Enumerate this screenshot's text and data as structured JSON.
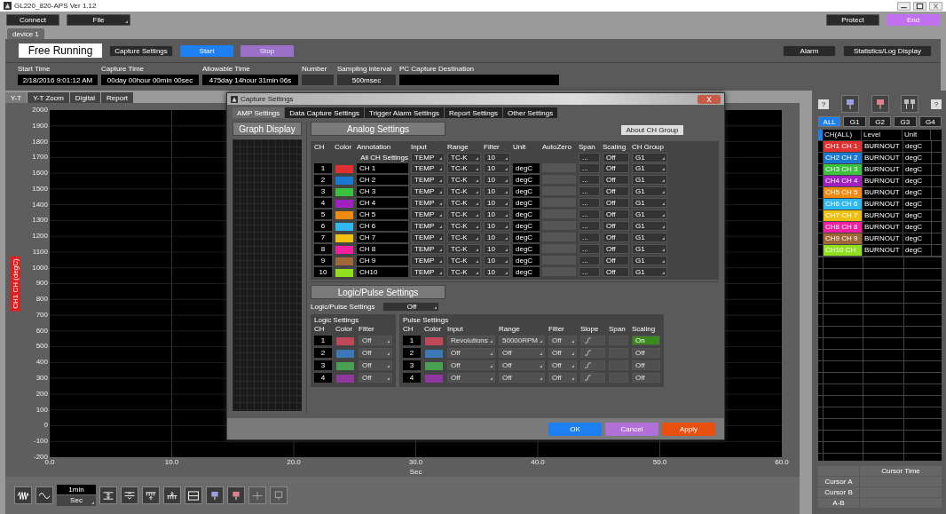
{
  "window": {
    "title": "GL220_820-APS Ver 1.12"
  },
  "toolbar": {
    "connect": "Connect",
    "file": "File",
    "protect": "Protect",
    "end": "End"
  },
  "device_tabs": [
    {
      "label": "device 1",
      "selected": true
    }
  ],
  "capture": {
    "mode": "Free Running",
    "settings_button": "Capture Settings",
    "start": "Start",
    "stop": "Stop",
    "alarm": "Alarm",
    "statistics": "Statistics/Log Display"
  },
  "info": [
    {
      "label": "Start Time",
      "value": "2/18/2016 9:01:12 AM"
    },
    {
      "label": "Capture Time",
      "value": "00day 00hour 00min 00sec"
    },
    {
      "label": "Allowable Time",
      "value": "475day 14hour 31min 06s"
    },
    {
      "label": "Number"
    },
    {
      "label": "Sampling interval",
      "value": "500msec"
    },
    {
      "label": "PC Capture Destination"
    }
  ],
  "view_tabs": [
    {
      "label": "Y-T",
      "selected": true
    },
    {
      "label": "Y-T Zoom",
      "selected": false
    },
    {
      "label": "Digital",
      "selected": false
    },
    {
      "label": "Report",
      "selected": false
    }
  ],
  "graph": {
    "ylabel": "CH1 CH (degC)",
    "yticks": [
      "2000",
      "1900",
      "1800",
      "1700",
      "1600",
      "1500",
      "1400",
      "1300",
      "1200",
      "1100",
      "1000",
      "900",
      "800",
      "700",
      "600",
      "500",
      "400",
      "300",
      "200",
      "100",
      "0",
      "-100",
      "-200"
    ],
    "xticks": [
      "0.0",
      "10.0",
      "20.0",
      "30.0",
      "40.0",
      "50.0",
      "60.0"
    ],
    "xlabel": "Sec"
  },
  "bottom_bar": {
    "time_span": "1min",
    "unit": "Sec"
  },
  "monitor": {
    "help": [
      "?",
      "?"
    ],
    "groups": [
      {
        "label": "ALL",
        "selected": true
      },
      {
        "label": "G1",
        "selected": false
      },
      {
        "label": "G2",
        "selected": false
      },
      {
        "label": "G3",
        "selected": false
      },
      {
        "label": "G4",
        "selected": false
      }
    ],
    "columns": [
      "CH(ALL)",
      "Level",
      "Unit"
    ],
    "rows": [
      {
        "channel": "CH1 CH 1",
        "color": "#e03030",
        "level": "BURNOUT",
        "unit": "degC"
      },
      {
        "channel": "CH2 CH 2",
        "color": "#1a78d0",
        "level": "BURNOUT",
        "unit": "degC"
      },
      {
        "channel": "CH3 CH 3",
        "color": "#3cc040",
        "level": "BURNOUT",
        "unit": "degC"
      },
      {
        "channel": "CH4 CH 4",
        "color": "#a020c0",
        "level": "BURNOUT",
        "unit": "degC"
      },
      {
        "channel": "CH5 CH 5",
        "color": "#f08a10",
        "level": "BURNOUT",
        "unit": "degC"
      },
      {
        "channel": "CH6 CH 6",
        "color": "#30b8f0",
        "level": "BURNOUT",
        "unit": "degC"
      },
      {
        "channel": "CH7 CH 7",
        "color": "#f0c010",
        "level": "BURNOUT",
        "unit": "degC"
      },
      {
        "channel": "CH8 CH 8",
        "color": "#f020a0",
        "level": "BURNOUT",
        "unit": "degC"
      },
      {
        "channel": "CH9 CH 9",
        "color": "#a06838",
        "level": "BURNOUT",
        "unit": "degC"
      },
      {
        "channel": "CH10 CH",
        "color": "#90e020",
        "level": "BURNOUT",
        "unit": "degC"
      }
    ],
    "cursor": {
      "header": "Cursor Time",
      "rows": [
        "Cursor A",
        "Cursor B",
        "A-B"
      ]
    }
  },
  "dialog": {
    "title": "Capture Settings",
    "tabs": [
      {
        "label": "AMP Settings",
        "selected": true
      },
      {
        "label": "Data Capture Settings",
        "selected": false
      },
      {
        "label": "Trigger Alarm Settings",
        "selected": false
      },
      {
        "label": "Report Settings",
        "selected": false
      },
      {
        "label": "Other Settings",
        "selected": false
      }
    ],
    "graph_display": "Graph Display",
    "analog": {
      "title": "Analog Settings",
      "about": "About CH Group",
      "all_label": "All CH Settings",
      "all": {
        "input": "TEMP",
        "range": "TC-K",
        "filter": "10",
        "span": "...",
        "scaling": "Off",
        "group": "G1"
      },
      "columns": [
        "CH",
        "Color",
        "Annotation",
        "Input",
        "Range",
        "Filter",
        "Unit",
        "AutoZero",
        "Span",
        "Scaling",
        "CH Group"
      ],
      "channels": [
        {
          "ch": "1",
          "color": "#e03030",
          "annotation": "CH 1",
          "input": "TEMP",
          "range": "TC-K",
          "filter": "10",
          "unit": "degC",
          "span": "...",
          "scaling": "Off",
          "group": "G1"
        },
        {
          "ch": "2",
          "color": "#1a78d0",
          "annotation": "CH 2",
          "input": "TEMP",
          "range": "TC-K",
          "filter": "10",
          "unit": "degC",
          "span": "...",
          "scaling": "Off",
          "group": "G1"
        },
        {
          "ch": "3",
          "color": "#3cc040",
          "annotation": "CH 3",
          "input": "TEMP",
          "range": "TC-K",
          "filter": "10",
          "unit": "degC",
          "span": "...",
          "scaling": "Off",
          "group": "G1"
        },
        {
          "ch": "4",
          "color": "#a020c0",
          "annotation": "CH 4",
          "input": "TEMP",
          "range": "TC-K",
          "filter": "10",
          "unit": "degC",
          "span": "...",
          "scaling": "Off",
          "group": "G1"
        },
        {
          "ch": "5",
          "color": "#f08a10",
          "annotation": "CH 5",
          "input": "TEMP",
          "range": "TC-K",
          "filter": "10",
          "unit": "degC",
          "span": "...",
          "scaling": "Off",
          "group": "G1"
        },
        {
          "ch": "6",
          "color": "#30b8f0",
          "annotation": "CH 6",
          "input": "TEMP",
          "range": "TC-K",
          "filter": "10",
          "unit": "degC",
          "span": "...",
          "scaling": "Off",
          "group": "G1"
        },
        {
          "ch": "7",
          "color": "#f0c010",
          "annotation": "CH 7",
          "input": "TEMP",
          "range": "TC-K",
          "filter": "10",
          "unit": "degC",
          "span": "...",
          "scaling": "Off",
          "group": "G1"
        },
        {
          "ch": "8",
          "color": "#f020a0",
          "annotation": "CH 8",
          "input": "TEMP",
          "range": "TC-K",
          "filter": "10",
          "unit": "degC",
          "span": "...",
          "scaling": "Off",
          "group": "G1"
        },
        {
          "ch": "9",
          "color": "#a06838",
          "annotation": "CH 9",
          "input": "TEMP",
          "range": "TC-K",
          "filter": "10",
          "unit": "degC",
          "span": "...",
          "scaling": "Off",
          "group": "G1"
        },
        {
          "ch": "10",
          "color": "#90e020",
          "annotation": "CH10",
          "input": "TEMP",
          "range": "TC-K",
          "filter": "10",
          "unit": "degC",
          "span": "...",
          "scaling": "Off",
          "group": "G1"
        }
      ]
    },
    "logic_pulse": {
      "title": "Logic/Pulse Settings",
      "setting_label": "Logic/Pulse Settings",
      "setting": "Off",
      "logic": {
        "title": "Logic Settings",
        "disabled": true,
        "columns": [
          "CH",
          "Color",
          "Filter"
        ],
        "rows": [
          {
            "ch": "1",
            "color": "#c04858",
            "filter": "Off"
          },
          {
            "ch": "2",
            "color": "#3a78b8",
            "filter": "Off"
          },
          {
            "ch": "3",
            "color": "#48a050",
            "filter": "Off"
          },
          {
            "ch": "4",
            "color": "#9038a0",
            "filter": "Off"
          }
        ]
      },
      "pulse": {
        "title": "Pulse Settings",
        "disabled": true,
        "columns": [
          "CH",
          "Color",
          "Input",
          "Range",
          "Filter",
          "Slope",
          "Span",
          "Scaling"
        ],
        "rows": [
          {
            "ch": "1",
            "color": "#c04858",
            "input": "Revolutions",
            "range": "50000RPM",
            "filter": "Off",
            "scaling": "On",
            "scaling_on": true
          },
          {
            "ch": "2",
            "color": "#3a78b8",
            "input": "Off",
            "range": "Off",
            "filter": "Off",
            "scaling": "Off",
            "scaling_on": false
          },
          {
            "ch": "3",
            "color": "#48a050",
            "input": "Off",
            "range": "Off",
            "filter": "Off",
            "scaling": "Off",
            "scaling_on": false
          },
          {
            "ch": "4",
            "color": "#9038a0",
            "input": "Off",
            "range": "Off",
            "filter": "Off",
            "scaling": "Off",
            "scaling_on": false
          }
        ]
      }
    },
    "buttons": {
      "ok": "OK",
      "cancel": "Cancel",
      "apply": "Apply"
    }
  }
}
